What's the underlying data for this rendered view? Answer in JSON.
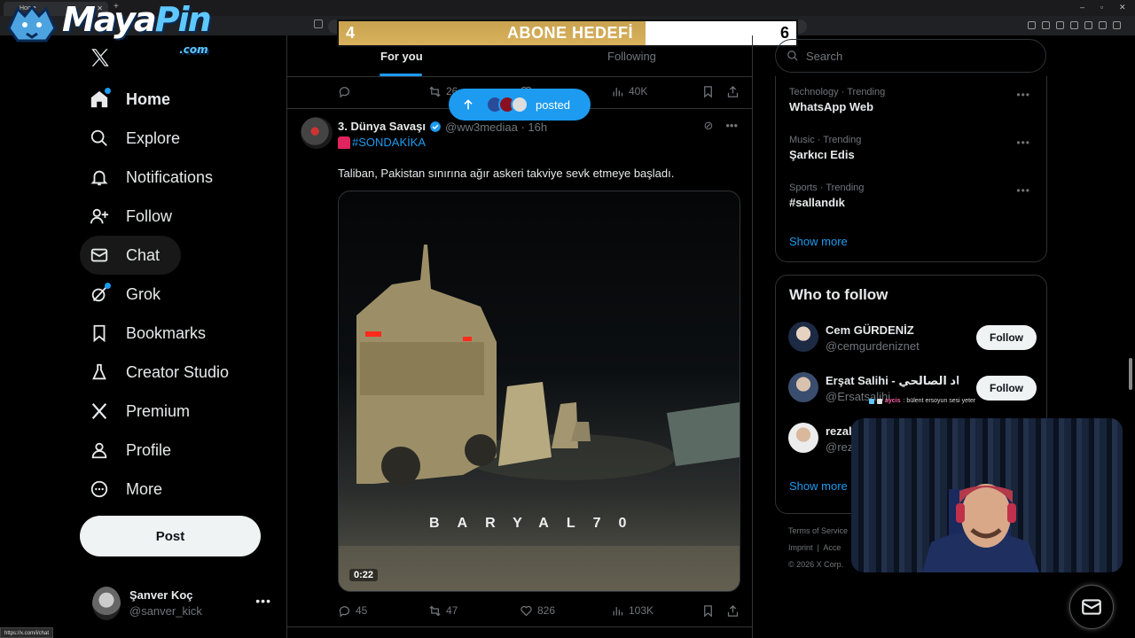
{
  "browser": {
    "tab_title": "Home",
    "status_url": "https://x.com/i/chat"
  },
  "overlay": {
    "logo_text_a": "Maya",
    "logo_text_b": "Pin",
    "logo_suffix": ".com",
    "goal_current": "4",
    "goal_label": "ABONE HEDEFİ",
    "goal_target": "6",
    "goal_progress": 0.67
  },
  "nav": {
    "items": [
      {
        "label": "Home",
        "icon": "home-icon"
      },
      {
        "label": "Explore",
        "icon": "search-icon"
      },
      {
        "label": "Notifications",
        "icon": "bell-icon"
      },
      {
        "label": "Follow",
        "icon": "person-plus-icon"
      },
      {
        "label": "Chat",
        "icon": "mail-icon"
      },
      {
        "label": "Grok",
        "icon": "grok-icon"
      },
      {
        "label": "Bookmarks",
        "icon": "bookmark-icon"
      },
      {
        "label": "Creator Studio",
        "icon": "flask-icon"
      },
      {
        "label": "Premium",
        "icon": "x-logo-icon"
      },
      {
        "label": "Profile",
        "icon": "person-icon"
      },
      {
        "label": "More",
        "icon": "more-circle-icon"
      }
    ],
    "post_label": "Post"
  },
  "account": {
    "name": "Şanver Koç",
    "handle": "@sanver_kick"
  },
  "timeline": {
    "tabs": [
      "For you",
      "Following"
    ],
    "prev_post_stats": {
      "replies": "",
      "reposts": "26",
      "likes": "",
      "views": "40K"
    },
    "new_posts_label": "posted",
    "post": {
      "author": "3. Dünya Savaşı",
      "handle": "@ww3mediaa",
      "time": "16h",
      "hashtag": "#SONDAKİKA",
      "text": "Taliban, Pakistan sınırına ağır askeri takviye sevk etmeye başladı.",
      "video_watermark": "BARYAL70",
      "video_duration": "0:22",
      "replies": "45",
      "reposts": "47",
      "likes": "826",
      "views": "103K"
    }
  },
  "sidebar": {
    "search_placeholder": "Search",
    "trends": [
      {
        "category": "Technology · Trending",
        "name": "WhatsApp Web"
      },
      {
        "category": "Music · Trending",
        "name": "Şarkıcı Edis"
      },
      {
        "category": "Sports · Trending",
        "name": "#sallandık"
      }
    ],
    "show_more": "Show more",
    "who_to_follow_title": "Who to follow",
    "suggestions": [
      {
        "name": "Cem GÜRDENİZ",
        "handle": "@cemgurdeniznet",
        "button": "Follow"
      },
      {
        "name": "Erşat Salihi - ارشاد الصالحي",
        "handle": "@Ersatsalihi",
        "button": "Follow"
      },
      {
        "name": "rezalet",
        "handle": "@rez",
        "button": ""
      }
    ],
    "footer_line1": "Terms of Service",
    "footer_line2_a": "Imprint",
    "footer_line2_b": "Acce",
    "footer_line3": "© 2026 X Corp."
  },
  "stream_chat": {
    "user": "aycis",
    "message": ": bülent ersoyun sesi yeter"
  },
  "colors": {
    "accent": "#1d9bf0",
    "background": "#000000",
    "border": "#2f3336",
    "muted": "#71767b",
    "goal_fill": "#c9a24f"
  }
}
